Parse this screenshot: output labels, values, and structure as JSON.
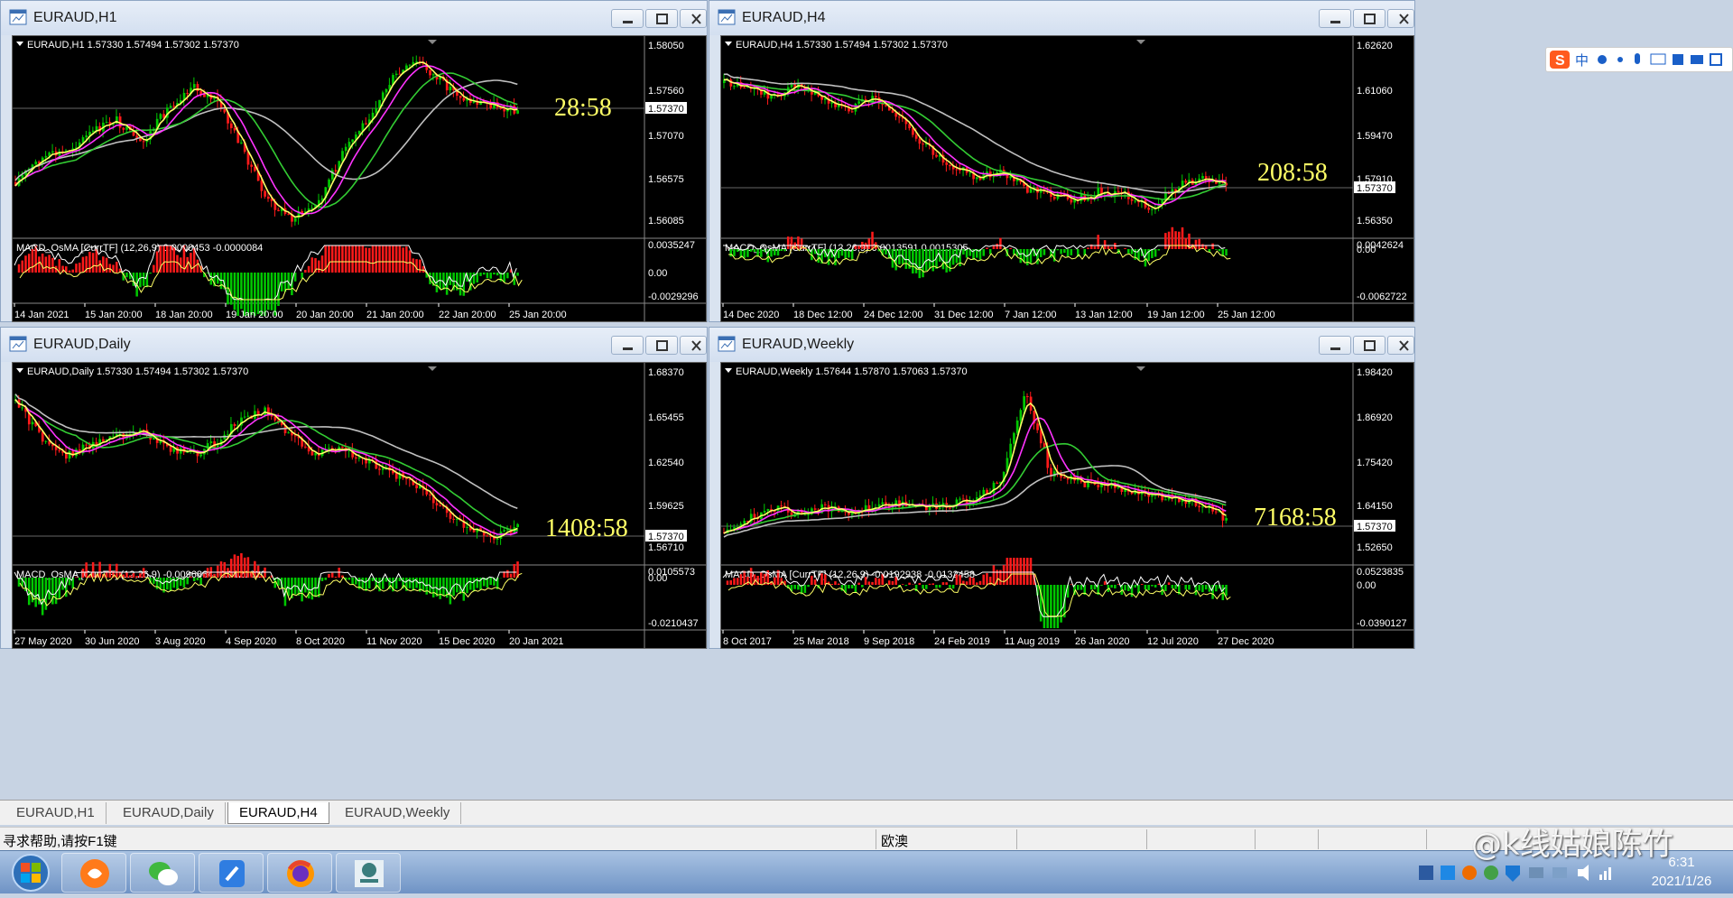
{
  "windows": [
    {
      "title": "EURAUD,H1",
      "info": "EURAUD,H1  1.57330 1.57494 1.57302 1.57370",
      "countdown": "28:58",
      "prices": [
        "1.58050",
        "1.57560",
        "1.57070",
        "1.56575",
        "1.56085"
      ],
      "current_price": "1.57370",
      "macd_label": "MACD_OsMA [CurrTF] (12,26,9) 0.0000453 -0.0000084",
      "macd_scale": [
        "0.0035247",
        "0.00",
        "-0.0029296"
      ],
      "dates": [
        "14 Jan 2021",
        "15 Jan 20:00",
        "18 Jan 20:00",
        "19 Jan 20:00",
        "20 Jan 20:00",
        "21 Jan 20:00",
        "22 Jan 20:00",
        "25 Jan 20:00"
      ]
    },
    {
      "title": "EURAUD,H4",
      "info": "EURAUD,H4  1.57330 1.57494 1.57302 1.57370",
      "countdown": "208:58",
      "prices": [
        "1.62620",
        "1.61060",
        "1.59470",
        "1.57910",
        "1.56350"
      ],
      "current_price": "1.57370",
      "macd_label": "MACD_OsMA [CurrTF] (12,26,9) 0.0013591 0.0015305",
      "macd_scale": [
        "0.0042624",
        "0.00",
        "-0.0062722"
      ],
      "dates": [
        "14 Dec 2020",
        "18 Dec 12:00",
        "24 Dec 12:00",
        "31 Dec 12:00",
        "7 Jan 12:00",
        "13 Jan 12:00",
        "19 Jan 12:00",
        "25 Jan 12:00"
      ]
    },
    {
      "title": "EURAUD,Daily",
      "info": "EURAUD,Daily  1.57330 1.57494 1.57302 1.57370",
      "countdown": "1408:58",
      "prices": [
        "1.68370",
        "1.65455",
        "1.62540",
        "1.59625",
        "1.56710"
      ],
      "current_price": "1.57370",
      "macd_label": "MACD_OsMA [CurrTF] (12,26,9) -0.0096864 -0.0121020",
      "macd_scale": [
        "0.0105573",
        "0.00",
        "-0.0210437"
      ],
      "dates": [
        "27 May 2020",
        "30 Jun 2020",
        "3 Aug 2020",
        "4 Sep 2020",
        "8 Oct 2020",
        "11 Nov 2020",
        "15 Dec 2020",
        "20 Jan 2021"
      ]
    },
    {
      "title": "EURAUD,Weekly",
      "info": "EURAUD,Weekly  1.57644 1.57870 1.57063 1.57370",
      "countdown": "7168:58",
      "prices": [
        "1.98420",
        "1.86920",
        "1.75420",
        "1.64150",
        "1.52650"
      ],
      "current_price": "1.57370",
      "macd_label": "MACD_OsMA [CurrTF] (12,26,9) -0.0192938 -0.0132458",
      "macd_scale": [
        "0.0523835",
        "0.00",
        "-0.0390127"
      ],
      "dates": [
        "8 Oct 2017",
        "25 Mar 2018",
        "9 Sep 2018",
        "24 Feb 2019",
        "11 Aug 2019",
        "26 Jan 2020",
        "12 Jul 2020",
        "27 Dec 2020"
      ]
    }
  ],
  "tabs": [
    {
      "label": "EURAUD,H1"
    },
    {
      "label": "EURAUD,Daily"
    },
    {
      "label": "EURAUD,H4"
    },
    {
      "label": "EURAUD,Weekly"
    }
  ],
  "active_tab": "EURAUD,H4",
  "status": {
    "help": "寻求帮助,请按F1键",
    "profile": "欧澳"
  },
  "taskbar": {
    "time": "6:31",
    "date": "2021/1/26",
    "apps": [
      "start",
      "firefox-like-app",
      "wechat",
      "notes",
      "firefox",
      "trading-terminal"
    ]
  },
  "watermark": "@k线姑娘陈竹",
  "ime": {
    "logo": "S",
    "mode": "中"
  },
  "colors": {
    "chart_bg": "#000000",
    "bull": "#00c800",
    "bear": "#ff1a1a",
    "ma_fast": "#ffff66",
    "ma_mid": "#ff33ff",
    "ma_slow": "#33cc33",
    "ma_long": "#c0c0c0",
    "countdown": "#ffff66"
  }
}
